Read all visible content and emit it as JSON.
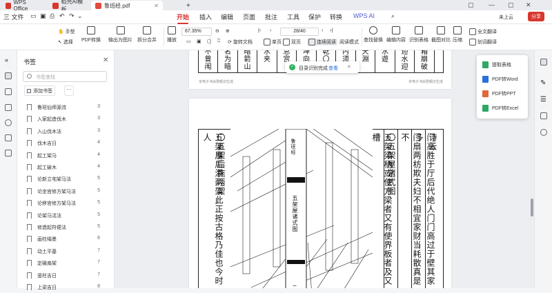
{
  "tabs": [
    {
      "label": "WPS Office",
      "color": "#d9362e"
    },
    {
      "label": "稻壳AI模板",
      "color": "#d9362e"
    },
    {
      "label": "鲁班经.pdf",
      "color": "#e04b3c"
    }
  ],
  "tab_add": "+",
  "window_controls": {
    "upload": "未上云",
    "share": "分享"
  },
  "menu": {
    "file": "三 文件",
    "items": [
      "开始",
      "插入",
      "编辑",
      "页面",
      "批注",
      "工具",
      "保护",
      "转换"
    ],
    "active": "开始",
    "ai": "WPS AI"
  },
  "ribbon": {
    "hand": "手型",
    "select": "选择",
    "pdf_convert": "PDF转换",
    "export_image": "输出为图片",
    "split_merge": "拆分合并",
    "play": "播放",
    "zoom": "67.35%",
    "page": "28/40",
    "rotate": "旋转文档",
    "single": "单页",
    "double": "双页",
    "continuous": "连续阅读",
    "read_mode": "阅读模式",
    "find": "查找替换",
    "edit_content": "编辑内容",
    "ocr_table": "识别表格",
    "screenshot": "截图对比",
    "compress": "压缩",
    "translate_all": "全文翻译",
    "translate_sel": "划词翻译"
  },
  "panel": {
    "title": "书签",
    "search_placeholder": "书签查找",
    "add_bookmark": "添加书签",
    "more": "···",
    "items": [
      {
        "label": "鲁班仙师源流",
        "page": "3"
      },
      {
        "label": "入家起造伐木",
        "page": "3"
      },
      {
        "label": "入山伐木法",
        "page": "3"
      },
      {
        "label": "伐木吉日",
        "page": "4"
      },
      {
        "label": "起工架马",
        "page": "4"
      },
      {
        "label": "起工破木",
        "page": "4"
      },
      {
        "label": "论新立宅架马法",
        "page": "5"
      },
      {
        "label": "论坐宫修方架马法",
        "page": "5"
      },
      {
        "label": "论移宫修方架马法",
        "page": "5"
      },
      {
        "label": "论架马活法",
        "page": "5"
      },
      {
        "label": "修造起符便法",
        "page": "5"
      },
      {
        "label": "画柱绳墨",
        "page": "6"
      },
      {
        "label": "动土平基",
        "page": "7"
      },
      {
        "label": "定磉扇架",
        "page": "7"
      },
      {
        "label": "竖柱吉日",
        "page": "7"
      },
      {
        "label": "上梁吉日",
        "page": "8"
      }
    ]
  },
  "toast": {
    "message": "目录识别完成",
    "view": "查看",
    "close": "✕"
  },
  "popup": [
    {
      "label": "提取表格",
      "color": "#2fa865"
    },
    {
      "label": "PDF转Word",
      "color": "#2d6fd9"
    },
    {
      "label": "PDF转PPT",
      "color": "#e0673a"
    },
    {
      "label": "PDF转Excel",
      "color": "#2fa865"
    }
  ],
  "page1": {
    "columns": [
      "不曾闱",
      "名为暗",
      "暗箭山",
      "水夹",
      "总宫",
      "坤向门",
      "乾〇犯",
      "内须防",
      "天淵",
      "水遊",
      "迎水迎",
      "箱崩破"
    ],
    "footer_left": "本电子书由慧眼识生成",
    "footer_right": "本电子书由慧眼识生成"
  },
  "page2": {
    "left_cols": [
      "五架屋后添两架此正按古格乃佳也今时人",
      "〇五架后拖两架"
    ],
    "right_cols": [
      "诗云",
      "门高胜于厅后代绝人门门高过于壁其家多",
      "门扇两枋欺夫妇不相宜家财当耗散真是不",
      "〇五架屋诸式图",
      "五架梁柄或使方梁者又有使界板者及又槽",
      "斗磉之类在主人之所为也"
    ],
    "banner_top": "鲁班经",
    "banner_title": "五架屋诸式图",
    "banner_bottom": "二"
  }
}
